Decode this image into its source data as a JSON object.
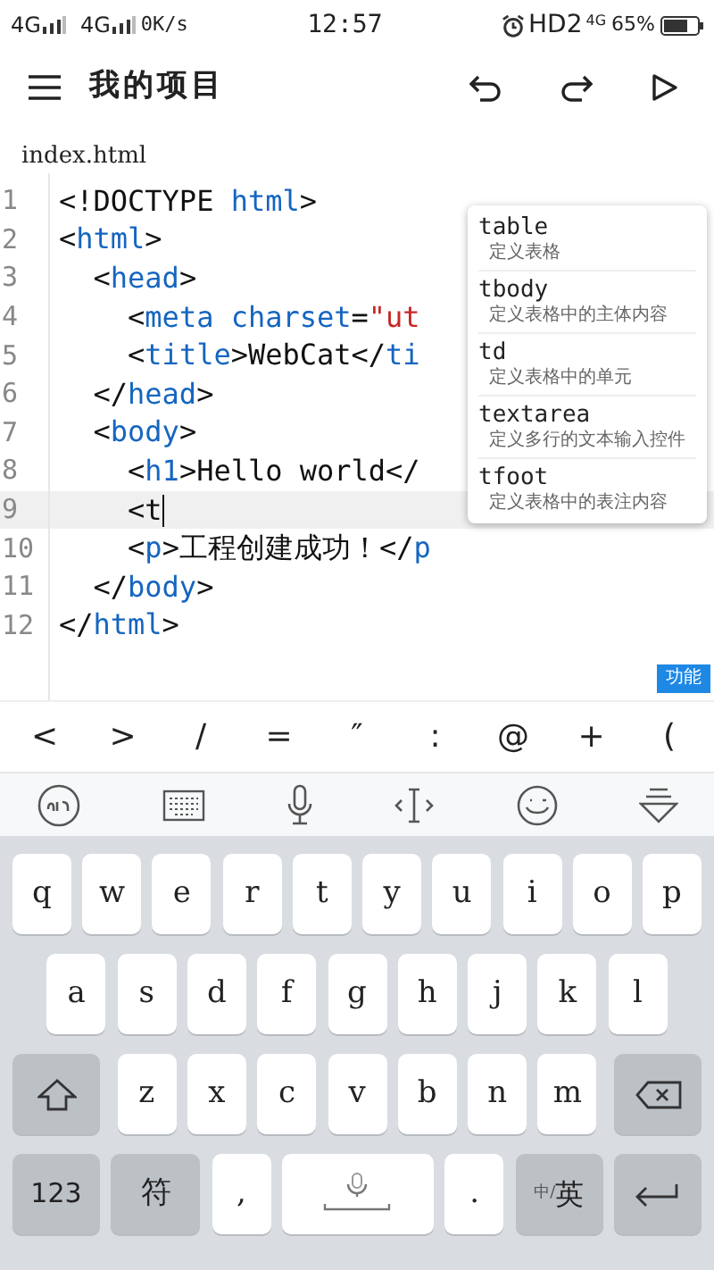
{
  "status_bar": {
    "left": [
      "4G",
      "4G",
      "0K/s"
    ],
    "time": "12:57",
    "hd": "HD2",
    "net": "4G",
    "battery": "65%"
  },
  "toolbar": {
    "title": "我的项目"
  },
  "file_name": "index.html",
  "editor": {
    "lines": [
      {
        "number": "1",
        "current": false,
        "tokens": [
          {
            "kind": "punct",
            "text": "<!DOCTYPE "
          },
          {
            "kind": "tag",
            "text": "html"
          },
          {
            "kind": "punct",
            "text": ">"
          }
        ]
      },
      {
        "number": "2",
        "current": false,
        "tokens": [
          {
            "kind": "punct",
            "text": "<"
          },
          {
            "kind": "tag",
            "text": "html"
          },
          {
            "kind": "punct",
            "text": ">"
          }
        ]
      },
      {
        "number": "3",
        "current": false,
        "tokens": [
          {
            "kind": "punct",
            "text": "  <"
          },
          {
            "kind": "tag",
            "text": "head"
          },
          {
            "kind": "punct",
            "text": ">"
          }
        ]
      },
      {
        "number": "4",
        "current": false,
        "tokens": [
          {
            "kind": "punct",
            "text": "    <"
          },
          {
            "kind": "tag",
            "text": "meta charset"
          },
          {
            "kind": "punct",
            "text": "="
          },
          {
            "kind": "string",
            "text": "\"ut"
          }
        ]
      },
      {
        "number": "5",
        "current": false,
        "tokens": [
          {
            "kind": "punct",
            "text": "    <"
          },
          {
            "kind": "tag",
            "text": "title"
          },
          {
            "kind": "punct",
            "text": ">WebCat</"
          },
          {
            "kind": "tag",
            "text": "ti"
          }
        ]
      },
      {
        "number": "6",
        "current": false,
        "tokens": [
          {
            "kind": "punct",
            "text": "  </"
          },
          {
            "kind": "tag",
            "text": "head"
          },
          {
            "kind": "punct",
            "text": ">"
          }
        ]
      },
      {
        "number": "7",
        "current": false,
        "tokens": [
          {
            "kind": "punct",
            "text": "  <"
          },
          {
            "kind": "tag",
            "text": "body"
          },
          {
            "kind": "punct",
            "text": ">"
          }
        ]
      },
      {
        "number": "8",
        "current": false,
        "tokens": [
          {
            "kind": "punct",
            "text": "    <"
          },
          {
            "kind": "tag",
            "text": "h1"
          },
          {
            "kind": "punct",
            "text": ">Hello world</"
          }
        ]
      },
      {
        "number": "9",
        "current": true,
        "tokens": [
          {
            "kind": "punct",
            "text": "    <t"
          }
        ]
      },
      {
        "number": "10",
        "current": false,
        "tokens": [
          {
            "kind": "punct",
            "text": "    <"
          },
          {
            "kind": "tag",
            "text": "p"
          },
          {
            "kind": "punct",
            "text": ">工程创建成功！</"
          },
          {
            "kind": "tag",
            "text": "p"
          }
        ]
      },
      {
        "number": "11",
        "current": false,
        "tokens": [
          {
            "kind": "punct",
            "text": "  </"
          },
          {
            "kind": "tag",
            "text": "body"
          },
          {
            "kind": "punct",
            "text": ">"
          }
        ]
      },
      {
        "number": "12",
        "current": false,
        "tokens": [
          {
            "kind": "punct",
            "text": "</"
          },
          {
            "kind": "tag",
            "text": "html"
          },
          {
            "kind": "punct",
            "text": ">"
          }
        ]
      }
    ]
  },
  "completion": [
    {
      "label": "table",
      "description": "定义表格"
    },
    {
      "label": "tbody",
      "description": "定义表格中的主体内容"
    },
    {
      "label": "td",
      "description": "定义表格中的单元"
    },
    {
      "label": "textarea",
      "description": "定义多行的文本输入控件"
    },
    {
      "label": "tfoot",
      "description": "定义表格中的表注内容"
    }
  ],
  "function_button": "功能",
  "symbols": [
    "<",
    ">",
    "/",
    "=",
    "″",
    ":",
    "@",
    "+",
    "("
  ],
  "keyboard": {
    "rows": [
      [
        "q",
        "w",
        "e",
        "r",
        "t",
        "y",
        "u",
        "i",
        "o",
        "p"
      ],
      [
        "a",
        "s",
        "d",
        "f",
        "g",
        "h",
        "j",
        "k",
        "l"
      ],
      [
        "z",
        "x",
        "c",
        "v",
        "b",
        "n",
        "m"
      ]
    ],
    "num_key": "123",
    "symbol_key": "符",
    "comma": ",",
    "period": ".",
    "lang_small": "中/",
    "lang": "英"
  }
}
